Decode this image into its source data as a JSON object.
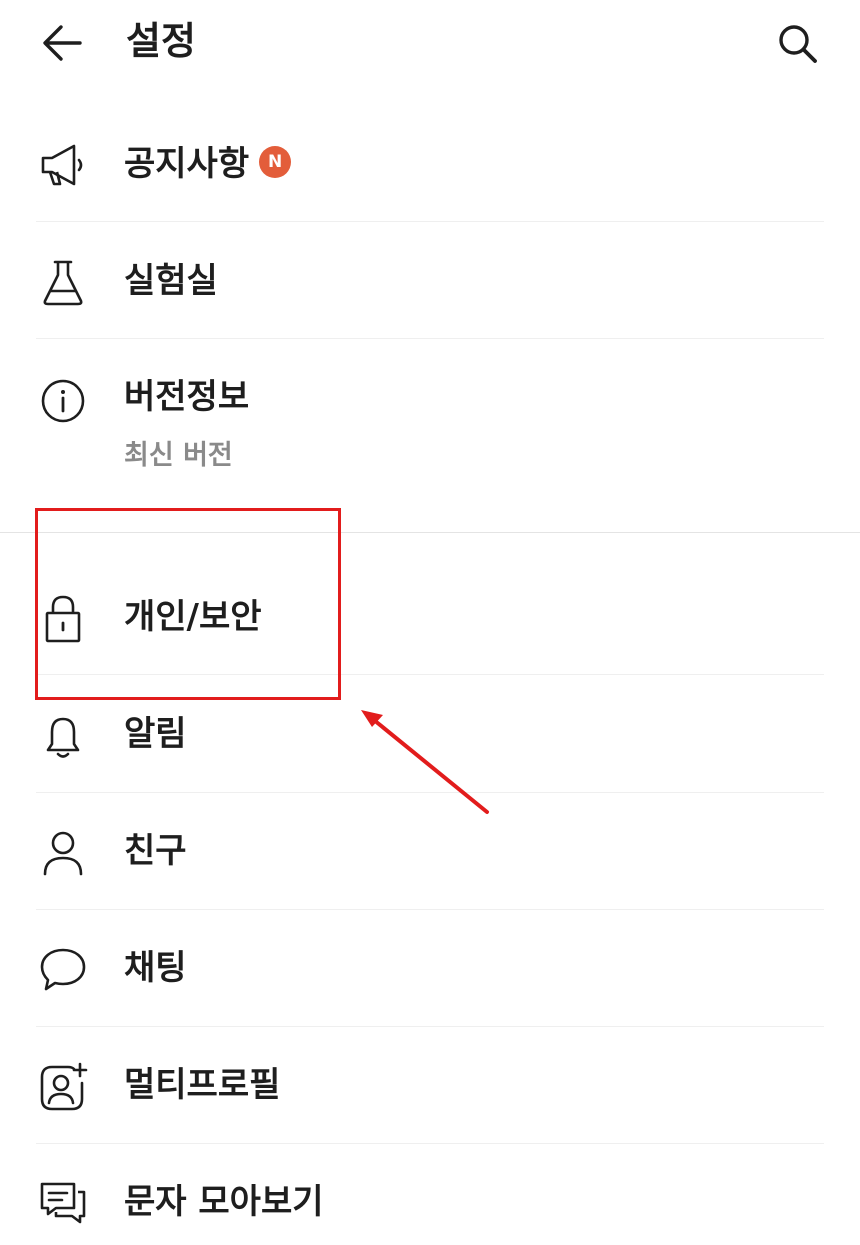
{
  "header": {
    "title": "설정",
    "back_icon": "arrow-left-icon",
    "search_icon": "search-icon"
  },
  "menu": [
    {
      "key": "notice",
      "label": "공지사항",
      "icon": "megaphone-icon",
      "badge": "N"
    },
    {
      "key": "lab",
      "label": "실험실",
      "icon": "flask-icon"
    },
    {
      "key": "version",
      "label": "버전정보",
      "icon": "info-icon",
      "sub": "최신 버전"
    },
    {
      "key": "privacy",
      "label": "개인/보안",
      "icon": "lock-icon"
    },
    {
      "key": "alarm",
      "label": "알림",
      "icon": "bell-icon"
    },
    {
      "key": "friends",
      "label": "친구",
      "icon": "person-icon"
    },
    {
      "key": "chat",
      "label": "채팅",
      "icon": "chat-bubble-icon"
    },
    {
      "key": "multiprofile",
      "label": "멀티프로필",
      "icon": "profile-add-icon"
    },
    {
      "key": "sms",
      "label": "문자 모아보기",
      "icon": "message-stack-icon"
    }
  ],
  "colors": {
    "badge": "#e35d3a",
    "annotation": "#e21c1c",
    "subtext": "#8a8a8a"
  }
}
